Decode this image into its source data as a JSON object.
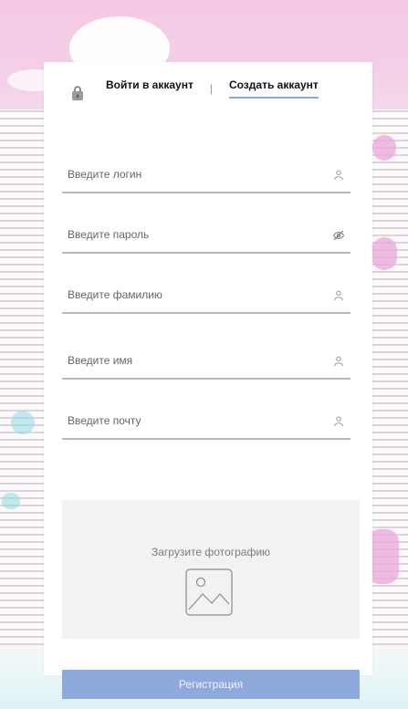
{
  "auth_tabs": {
    "login_label": "Войти в аккаунт",
    "separator": "|",
    "register_label": "Создать аккаунт",
    "active": "register"
  },
  "form": {
    "fields": [
      {
        "label": "Введите логин",
        "icon": "user-icon"
      },
      {
        "label": "Введите пароль",
        "icon": "eye-off-icon"
      },
      {
        "label": "Введите фамилию",
        "icon": "user-icon"
      },
      {
        "label": "Введите имя",
        "icon": "user-icon"
      },
      {
        "label": "Введите почту",
        "icon": "user-icon"
      }
    ],
    "upload": {
      "title": "Загрузите фотографию",
      "icon": "image-icon"
    },
    "submit_label": "Регистрация"
  },
  "theme": {
    "accent": "#8eaadd",
    "card_bg": "#ffffff",
    "upload_bg": "#f2f2f2",
    "underline": "#b7b7b7"
  }
}
